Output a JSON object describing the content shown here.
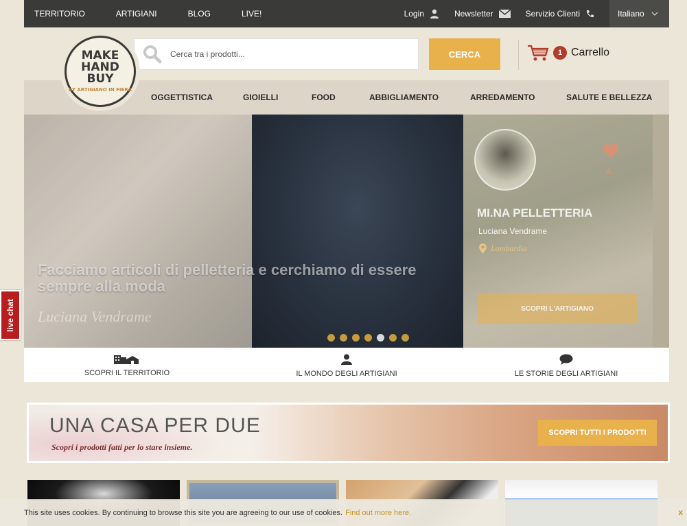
{
  "topbar": {
    "links": [
      "TERRITORIO",
      "ARTIGIANI",
      "BLOG",
      "LIVE!"
    ],
    "login": "Login",
    "newsletter": "Newsletter",
    "service": "Servizio Clienti",
    "language": "Italiano"
  },
  "logo": {
    "line1": "MAKE",
    "line2": "HAND",
    "line3": "BUY",
    "sub": "BY ARTIGIANO IN FIERA"
  },
  "search": {
    "placeholder": "Cerca tra i prodotti...",
    "button": "CERCA"
  },
  "cart": {
    "count": "1",
    "label": "Carrello"
  },
  "nav": [
    "OGGETTISTICA",
    "GIOIELLI",
    "FOOD",
    "ABBIGLIAMENTO",
    "ARREDAMENTO",
    "SALUTE E BELLEZZA"
  ],
  "hero": {
    "quote": "Facciamo articoli di pelletteria e cerchiamo di essere sempre alla moda",
    "quote_author": "Luciana Vendrame",
    "likes": "4",
    "shop_name": "MI.NA PELLETTERIA",
    "owner": "Luciana Vendrame",
    "region": "Lombardia",
    "button": "SCOPRI L'ARTIGIANO",
    "slides": 7,
    "active_slide": 5
  },
  "features": [
    {
      "label": "SCOPRI IL TERRITORIO",
      "icon": "town-icon"
    },
    {
      "label": "IL MONDO DEGLI ARTIGIANI",
      "icon": "person-icon"
    },
    {
      "label": "LE STORIE DEGLI ARTIGIANI",
      "icon": "chat-bubble-icon"
    }
  ],
  "banner": {
    "title": "UNA CASA PER DUE",
    "subtitle": "Scopri i prodotti fatti per lo stare insieme.",
    "button": "SCOPRI TUTTI I PRODOTTI"
  },
  "cookie": {
    "text": "This site uses cookies. By continuing to browse this site you are agreeing to our use of cookies.",
    "link": "Find out more here.",
    "close": "x"
  },
  "livechat": "live chat",
  "colors": {
    "accent": "#e8b14c",
    "dark": "#3a3a38",
    "badge": "#b33b2a",
    "chat": "#b81e1e"
  }
}
